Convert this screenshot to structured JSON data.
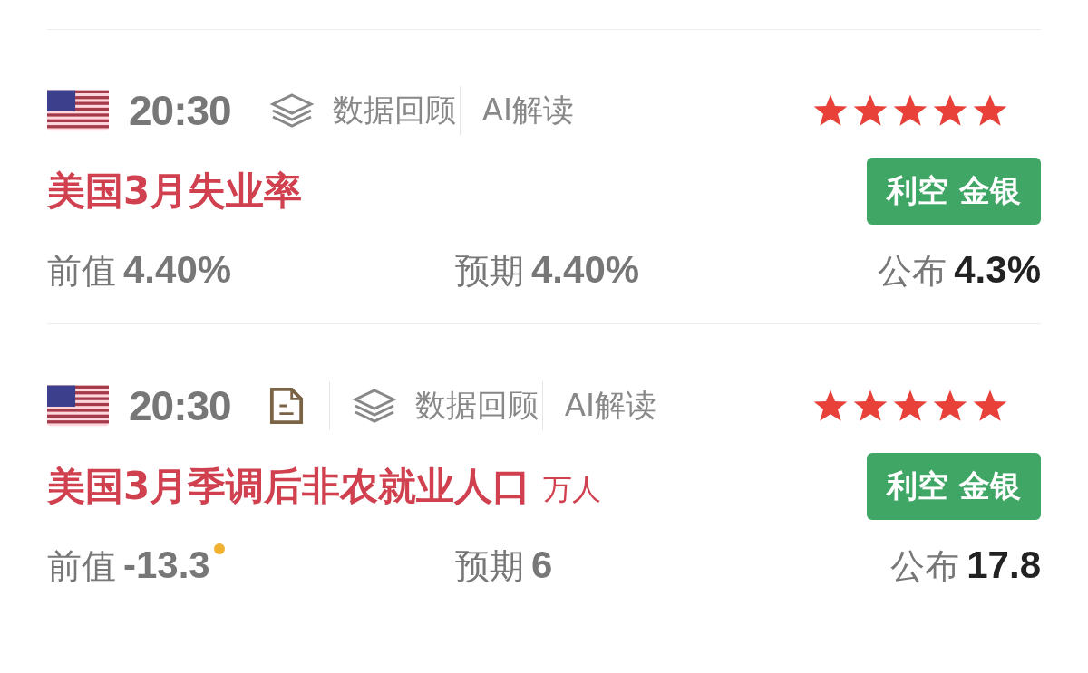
{
  "events": [
    {
      "time": "20:30",
      "has_document": false,
      "review": "数据回顾",
      "ai": "AI解读",
      "stars": 5,
      "title": "美国3月失业率",
      "tag": "利空 金银",
      "previous": {
        "label": "前值",
        "value": "4.40%",
        "revised": false
      },
      "forecast": {
        "label": "预期",
        "value": "4.40%"
      },
      "actual": {
        "label": "公布",
        "value": "4.3%"
      }
    },
    {
      "time": "20:30",
      "has_document": true,
      "review": "数据回顾",
      "ai": "AI解读",
      "stars": 5,
      "title": "美国3月季调后非农就业人口",
      "unit": "万人",
      "tag": "利空 金银",
      "previous": {
        "label": "前值",
        "value": "-13.3",
        "revised": true
      },
      "forecast": {
        "label": "预期",
        "value": "6"
      },
      "actual": {
        "label": "公布",
        "value": "17.8"
      }
    }
  ]
}
